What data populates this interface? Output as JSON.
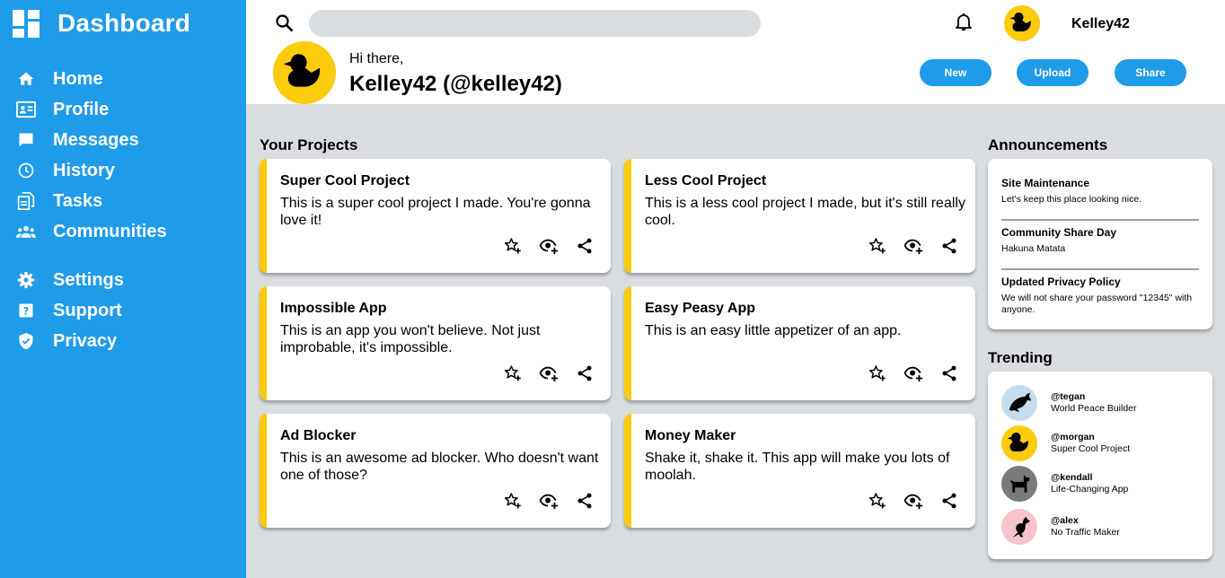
{
  "sidebar": {
    "title": "Dashboard",
    "items": [
      {
        "label": "Home",
        "icon": "home-icon"
      },
      {
        "label": "Profile",
        "icon": "profile-card-icon"
      },
      {
        "label": "Messages",
        "icon": "message-icon"
      },
      {
        "label": "History",
        "icon": "clock-icon"
      },
      {
        "label": "Tasks",
        "icon": "tasks-icon"
      },
      {
        "label": "Communities",
        "icon": "people-icon"
      },
      {
        "label": "Settings",
        "icon": "gear-icon"
      },
      {
        "label": "Support",
        "icon": "help-icon"
      },
      {
        "label": "Privacy",
        "icon": "shield-icon"
      }
    ]
  },
  "header": {
    "search_placeholder": "",
    "username": "Kelley42",
    "greeting": "Hi there,",
    "full_name": "Kelley42 (@kelley42)",
    "buttons": {
      "new": "New",
      "upload": "Upload",
      "share": "Share"
    }
  },
  "projects": {
    "title": "Your Projects",
    "items": [
      {
        "title": "Super Cool Project",
        "desc": "This is a super cool project I made. You're gonna love it!"
      },
      {
        "title": "Less Cool Project",
        "desc": "This is a less cool project I made, but it's still really cool."
      },
      {
        "title": "Impossible App",
        "desc": "This is an app you won't believe. Not just improbable, it's impossible."
      },
      {
        "title": "Easy Peasy App",
        "desc": "This is an easy little appetizer of an app."
      },
      {
        "title": "Ad Blocker",
        "desc": "This is an awesome ad blocker. Who doesn't want one of those?"
      },
      {
        "title": "Money Maker",
        "desc": "Shake it, shake it. This app will make you lots of moolah."
      }
    ]
  },
  "announcements": {
    "title": "Announcements",
    "items": [
      {
        "title": "Site Maintenance",
        "text": "Let's keep this place looking nice."
      },
      {
        "title": "Community Share Day",
        "text": "Hakuna Matata"
      },
      {
        "title": "Updated Privacy Policy",
        "text": "We will not share your password \"12345\" with anyone."
      }
    ]
  },
  "trending": {
    "title": "Trending",
    "items": [
      {
        "handle": "@tegan",
        "project": "World Peace Builder",
        "avatar": "dolphin-icon",
        "color": "#c5dcec"
      },
      {
        "handle": "@morgan",
        "project": "Super Cool Project",
        "avatar": "duck-icon",
        "color": "#fccb0b"
      },
      {
        "handle": "@kendall",
        "project": "Life-Changing App",
        "avatar": "dog-icon",
        "color": "#7a7a7a"
      },
      {
        "handle": "@alex",
        "project": "No Traffic Maker",
        "avatar": "kangaroo-icon",
        "color": "#f8c3cb"
      }
    ]
  },
  "colors": {
    "accent": "#1e9be9",
    "card_stripe": "#fccb0b",
    "background": "#d9dde0"
  }
}
